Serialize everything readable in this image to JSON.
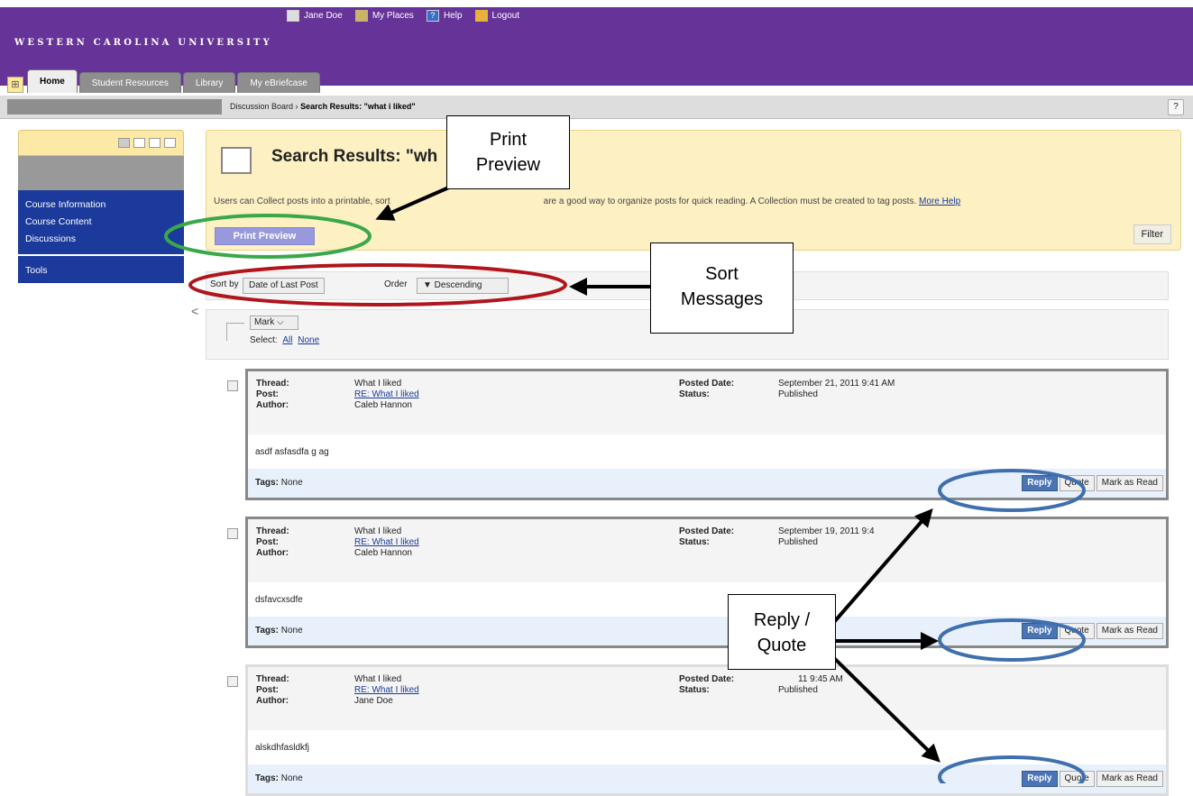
{
  "topnav": {
    "user": "Jane Doe",
    "places": "My Places",
    "help": "Help",
    "logout": "Logout"
  },
  "university": "WESTERN CAROLINA UNIVERSITY",
  "tabs": [
    "Home",
    "Student Resources",
    "Library",
    "My eBriefcase"
  ],
  "breadcrumb": {
    "root": "Discussion Board",
    "sep": "›",
    "current": "Search Results: \"what i liked\""
  },
  "help_button": "?",
  "sidebar": {
    "items": [
      "Course Information",
      "Course Content",
      "Discussions"
    ],
    "tools": "Tools",
    "collapse": "<"
  },
  "page": {
    "title": "Search Results: \"wh",
    "desc_part1": "Users can Collect posts into a printable, sort",
    "desc_part2": "are a good way to organize posts for quick reading. A Collection must be created to tag posts.",
    "more_help": "More Help",
    "print_preview": "Print Preview",
    "filter": "Filter"
  },
  "sort": {
    "label": "Sort by",
    "value": "Date of Last Post",
    "order_label": "Order",
    "order_value": "▼ Descending"
  },
  "mark": {
    "button": "Mark ⌵",
    "select_label": "Select:",
    "all": "All",
    "none": "None"
  },
  "labels": {
    "thread": "Thread:",
    "post": "Post:",
    "author": "Author:",
    "posted": "Posted Date:",
    "status": "Status:",
    "tags": "Tags:",
    "reply": "Reply",
    "quote": "Quote",
    "mark_read": "Mark as Read"
  },
  "posts": [
    {
      "thread": "What I liked",
      "post": "RE: What I liked",
      "author": "Caleb Hannon",
      "date": "September 21, 2011 9:41 AM",
      "status": "Published",
      "body": "asdf asfasdfa g ag",
      "tags": "None"
    },
    {
      "thread": "What I liked",
      "post": "RE: What I liked",
      "author": "Caleb Hannon",
      "date": "September 19, 2011 9:4",
      "status": "Published",
      "body": "dsfavcxsdfe",
      "tags": "None"
    },
    {
      "thread": "What I liked",
      "post": "RE: What I liked",
      "author": "Jane Doe",
      "date": "11 9:45 AM",
      "status": "Published",
      "body": "alskdhfasldkfj",
      "tags": "None"
    }
  ],
  "callouts": {
    "print_preview_1": "Print",
    "print_preview_2": "Preview",
    "sort_1": "Sort",
    "sort_2": "Messages",
    "reply_1": "Reply /",
    "reply_2": "Quote"
  },
  "colors": {
    "purple": "#663399",
    "nav_blue": "#1b3a9b",
    "green_ring": "#3aa84a",
    "red_ring": "#b0141c",
    "blue_ring": "#3f6fae"
  }
}
